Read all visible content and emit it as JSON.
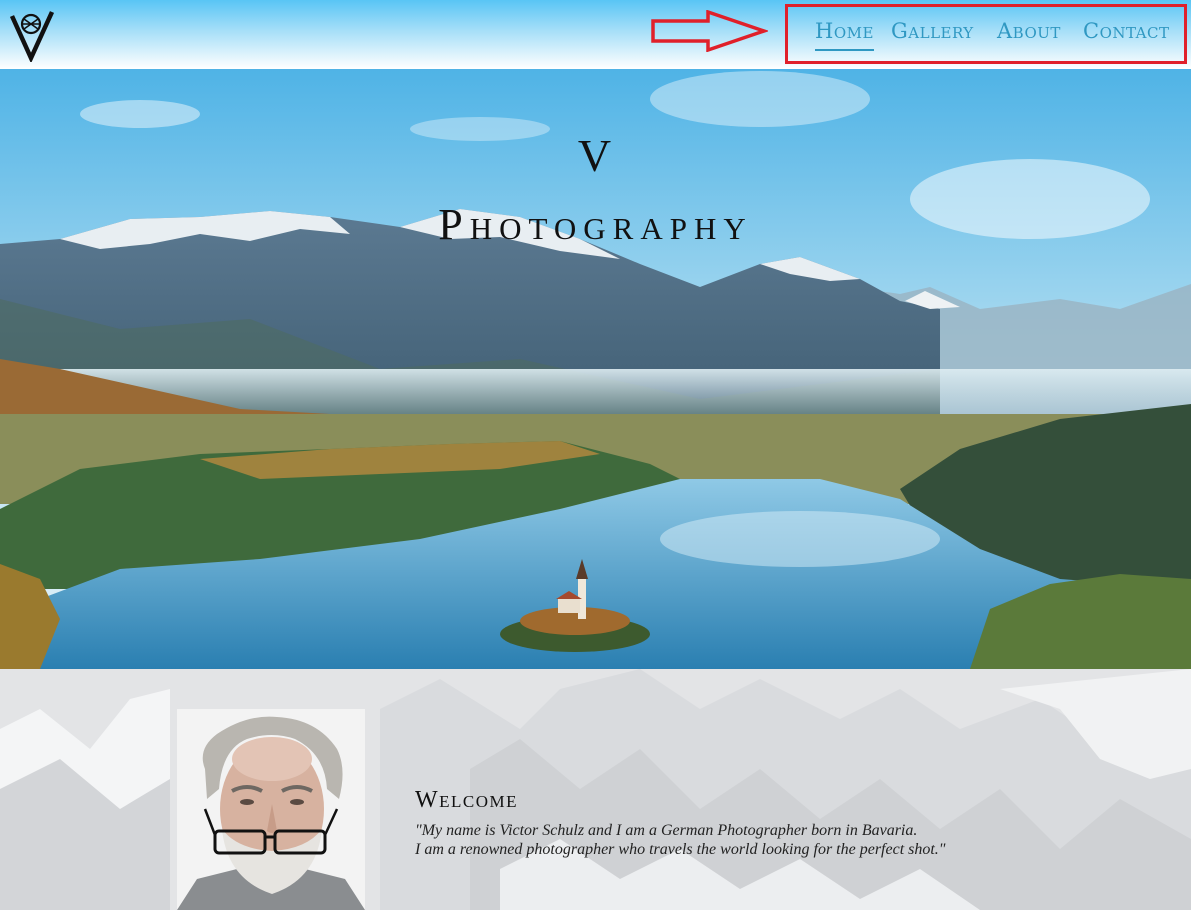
{
  "header": {
    "logo_icon": "v-monogram-logo-icon",
    "annotation_icon": "red-arrow-icon",
    "highlight_color": "#e0202a",
    "accent_color": "#2f98c2",
    "nav": [
      {
        "label": "Home",
        "active": true
      },
      {
        "label": "Gallery",
        "active": false
      },
      {
        "label": "About",
        "active": false
      },
      {
        "label": "Contact",
        "active": false
      }
    ]
  },
  "hero": {
    "title_line1": "V",
    "title_line2": "Photography",
    "image": "mountain-lake-landscape-photo"
  },
  "welcome": {
    "heading": "Welcome",
    "text_line1": "\"My name is Victor Schulz and I am a German Photographer born in Bavaria.",
    "text_line2": "I am a renowned photographer who travels the world looking for the perfect shot.\"",
    "portrait": "photographer-portrait-photo"
  }
}
